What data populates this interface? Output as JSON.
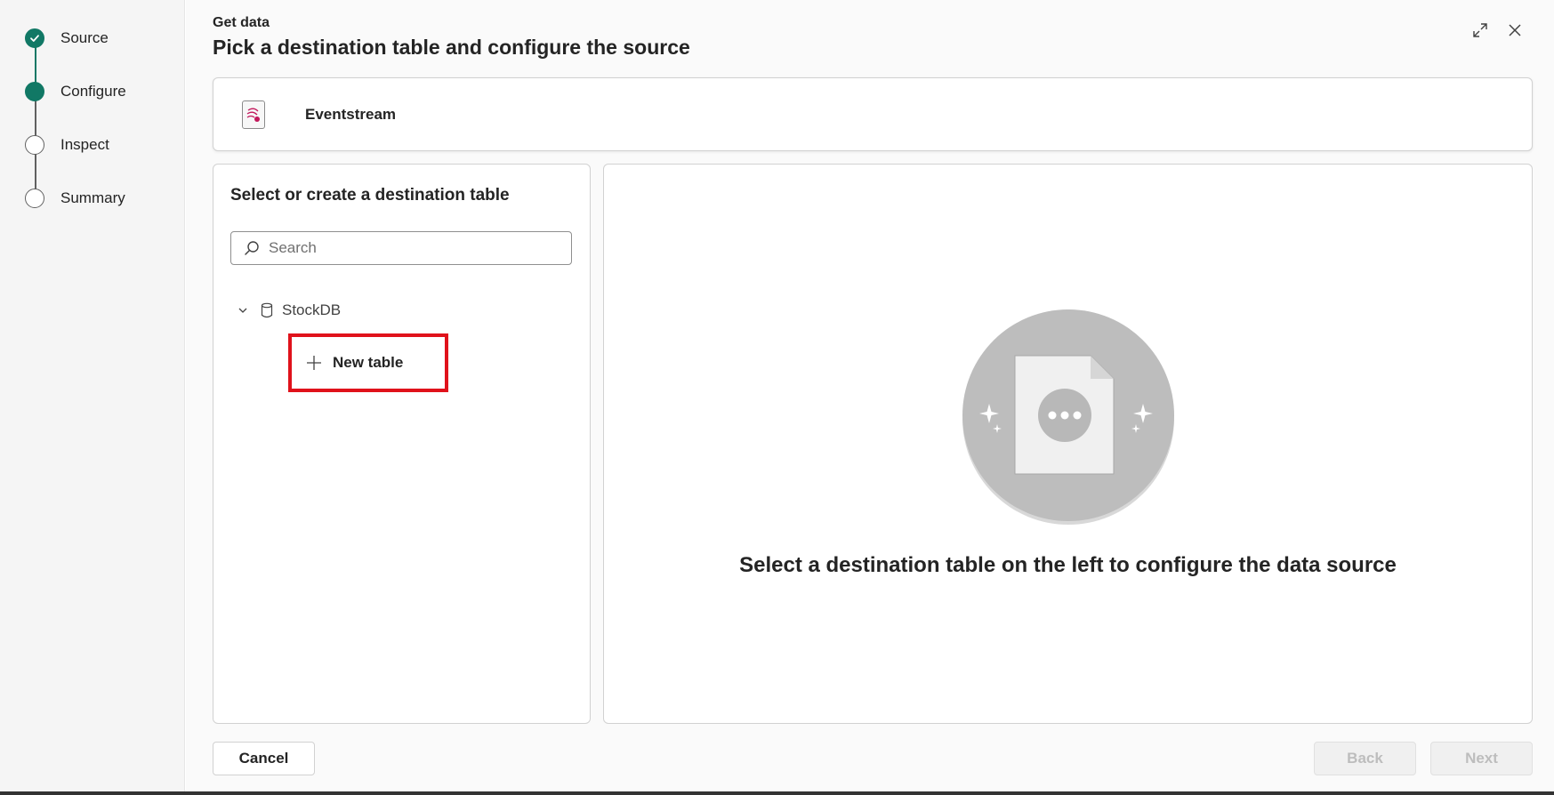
{
  "stepper": {
    "steps": [
      {
        "label": "Source",
        "state": "done"
      },
      {
        "label": "Configure",
        "state": "current"
      },
      {
        "label": "Inspect",
        "state": "pending"
      },
      {
        "label": "Summary",
        "state": "pending"
      }
    ]
  },
  "header": {
    "kicker": "Get data",
    "title": "Pick a destination table and configure the source"
  },
  "window_controls": [
    "expand-icon",
    "close-icon"
  ],
  "source": {
    "name": "Eventstream",
    "icon": "eventstream-icon"
  },
  "left_panel": {
    "title": "Select or create a destination table",
    "search": {
      "placeholder": "Search",
      "value": ""
    },
    "tree": {
      "database": {
        "name": "StockDB",
        "expanded": true
      },
      "new_table_label": "New table"
    }
  },
  "right_panel": {
    "empty_message": "Select a destination table on the left to configure the data source"
  },
  "footer": {
    "cancel_label": "Cancel",
    "back_label": "Back",
    "next_label": "Next"
  },
  "colors": {
    "accent": "#117865",
    "highlight_box": "#e0121b",
    "disabled_text": "#bdbdbd"
  }
}
